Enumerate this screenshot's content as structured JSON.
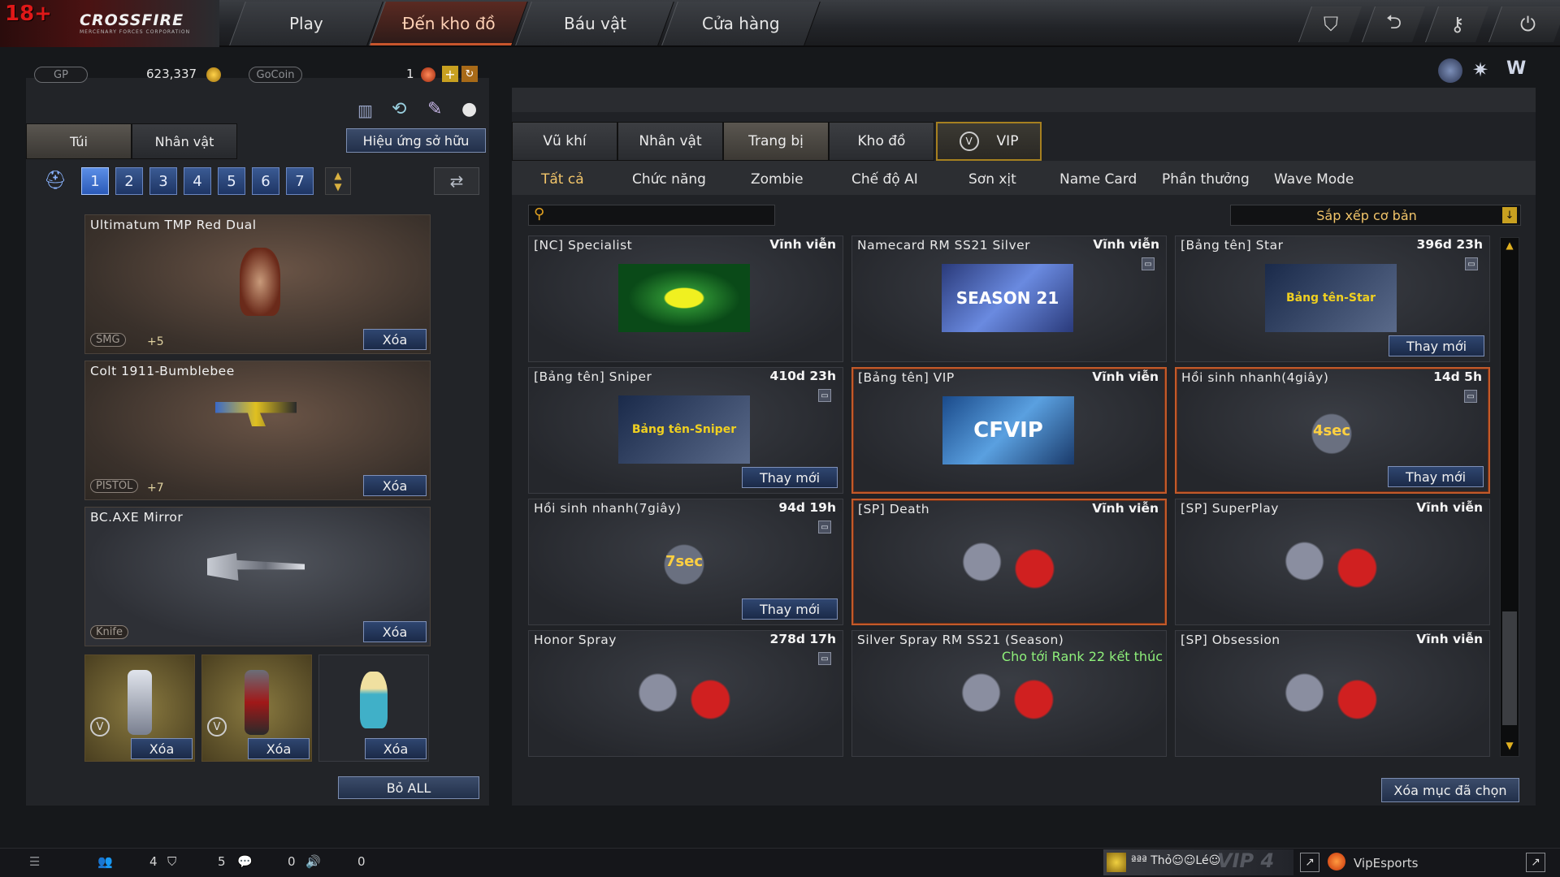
{
  "topbar": {
    "logo_age": "18+",
    "logo_brand": "CROSSFIRE",
    "logo_sub": "MERCENARY FORCES CORPORATION",
    "nav": [
      "Play",
      "Đến kho đồ",
      "Báu vật",
      "Cửa hàng"
    ],
    "active_nav": "Đến kho đồ",
    "icons": [
      "shield-icon",
      "return-icon",
      "key-icon",
      "power-icon"
    ]
  },
  "currency": {
    "gp_label": "GP",
    "gp_value": "623,337",
    "gocoin_label": "GoCoin",
    "count": "1"
  },
  "left": {
    "tabs": [
      "Túi",
      "Nhân vật"
    ],
    "effect_button": "Hiệu ứng sở hữu",
    "bag_numbers": [
      "1",
      "2",
      "3",
      "4",
      "5",
      "6",
      "7"
    ],
    "active_bag": "1",
    "weapons": [
      {
        "title": "Ultimatum TMP Red Dual",
        "type": "SMG",
        "plus": "+5",
        "remove": "Xóa"
      },
      {
        "title": "Colt 1911-Bumblebee",
        "type": "PISTOL",
        "plus": "+7",
        "remove": "Xóa"
      },
      {
        "title": "BC.AXE Mirror",
        "type": "Knife",
        "plus": "",
        "remove": "Xóa"
      }
    ],
    "slots": [
      {
        "remove": "Xóa"
      },
      {
        "remove": "Xóa"
      },
      {
        "remove": "Xóa"
      }
    ],
    "remove_all": "Bỏ ALL"
  },
  "right": {
    "tabs": [
      "Vũ khí",
      "Nhân vật",
      "Trang bị",
      "Kho đồ",
      "VIP"
    ],
    "active_tab": "Trang bị",
    "subtabs": [
      "Tất cả",
      "Chức năng",
      "Zombie",
      "Chế độ AI",
      "Sơn xịt",
      "Name Card",
      "Phần thưởng",
      "Wave Mode"
    ],
    "active_subtab": "Tất cả",
    "search_placeholder": "",
    "sort_label": "Sắp xếp cơ bản",
    "items": [
      {
        "name": "[NC] Specialist",
        "duration": "Vĩnh viễn",
        "picture": "radiation",
        "renew": "",
        "note": "",
        "trash": false,
        "selected": false
      },
      {
        "name": "Namecard RM SS21 Silver",
        "duration": "Vĩnh viễn",
        "picture": "SEASON 21",
        "renew": "",
        "note": "",
        "trash": true,
        "selected": false
      },
      {
        "name": "[Bảng tên] Star",
        "duration": "396d 23h",
        "picture": "Bảng tên-Star",
        "renew": "Thay mới",
        "note": "",
        "trash": true,
        "selected": false
      },
      {
        "name": "[Bảng tên] Sniper",
        "duration": "410d 23h",
        "picture": "Bảng tên-Sniper",
        "renew": "Thay mới",
        "note": "",
        "trash": true,
        "selected": false
      },
      {
        "name": "[Bảng tên] VIP",
        "duration": "Vĩnh viễn",
        "picture": "CFVIP",
        "renew": "",
        "note": "",
        "trash": false,
        "selected": true
      },
      {
        "name": "Hồi sinh nhanh(4giây)",
        "duration": "14d 5h",
        "picture": "4sec",
        "renew": "Thay mới",
        "note": "",
        "trash": true,
        "selected": true
      },
      {
        "name": "Hồi sinh nhanh(7giây)",
        "duration": "94d 19h",
        "picture": "7sec",
        "renew": "Thay mới",
        "note": "",
        "trash": true,
        "selected": false
      },
      {
        "name": "[SP] Death",
        "duration": "Vĩnh viễn",
        "picture": "spray",
        "renew": "",
        "note": "",
        "trash": false,
        "selected": true
      },
      {
        "name": "[SP] SuperPlay",
        "duration": "Vĩnh viễn",
        "picture": "spray",
        "renew": "",
        "note": "",
        "trash": false,
        "selected": false
      },
      {
        "name": "Honor Spray",
        "duration": "278d 17h",
        "picture": "spray",
        "renew": "",
        "note": "",
        "trash": true,
        "selected": false
      },
      {
        "name": "Silver Spray RM SS21 (Season)",
        "duration": "",
        "picture": "spray",
        "renew": "",
        "note": "Cho tới Rank 22 kết thúc",
        "trash": false,
        "selected": false
      },
      {
        "name": "[SP] Obsession",
        "duration": "Vĩnh viễn",
        "picture": "spray",
        "renew": "",
        "note": "",
        "trash": false,
        "selected": false
      }
    ],
    "delete_selected": "Xóa mục đã chọn"
  },
  "status": {
    "count_a": "4",
    "count_b": "5",
    "count_c": "0",
    "count_d": "0",
    "player_name": "ªªª Thỏ☺☺Lé☺",
    "player_rank_text": "VIP 4",
    "clan": "VipEsports"
  },
  "colors": {
    "accent_orange": "#c25a2a",
    "button_blue": "#2f4670",
    "gold": "#f2c56a",
    "note_green": "#8ef07a"
  }
}
